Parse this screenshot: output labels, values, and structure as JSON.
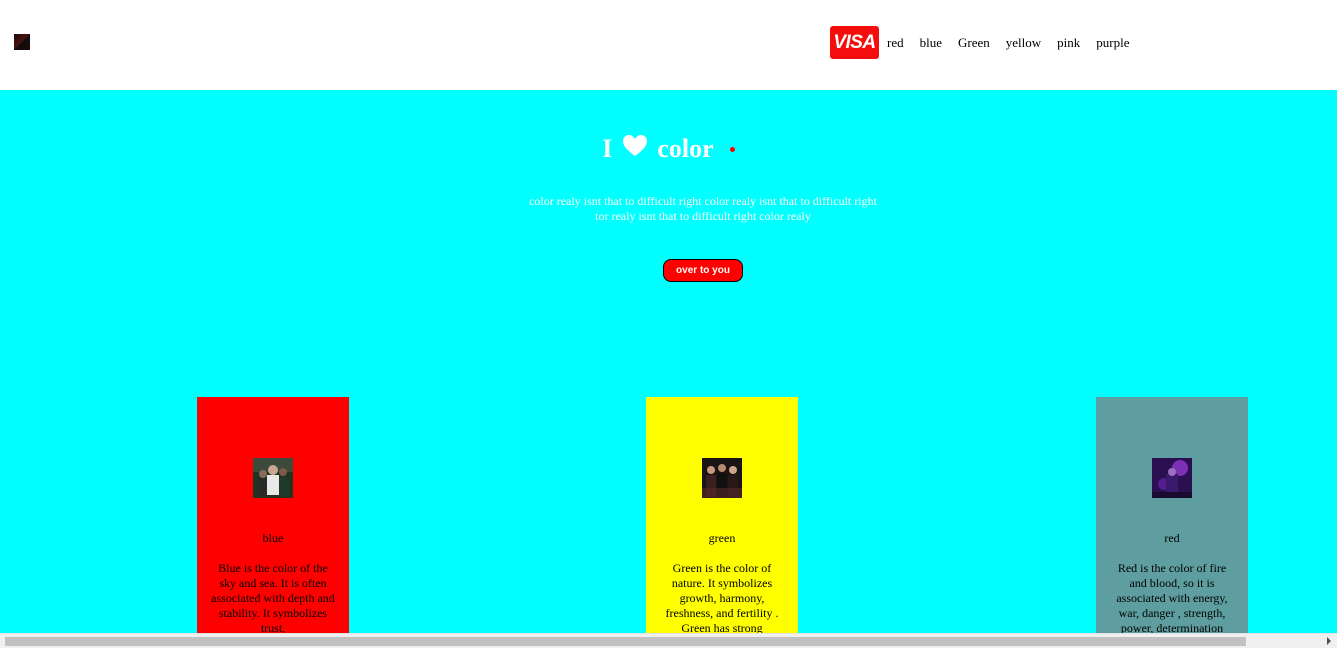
{
  "header": {
    "logo_icon": "dark-red-square-logo",
    "brand_badge": "VISA",
    "nav": [
      "red",
      "blue",
      "Green",
      "yellow",
      "pink",
      "purple"
    ]
  },
  "hero": {
    "title_prefix": "I",
    "title_icon": "heart-icon",
    "title_suffix": "color",
    "text": "color realy isnt that to difficult right color realy isnt that to difficult right tor realy isnt that to difficult right color realy",
    "cta_label": "over to you",
    "background": "#00ffff",
    "cta_color": "#ff0000"
  },
  "cards": [
    {
      "title": "blue",
      "text": "Blue is the color of the sky and sea. It is often associated with depth and stability. It symbolizes trust,",
      "background": "#ff0000",
      "thumb_icon": "photo-thumbnail"
    },
    {
      "title": "green",
      "text": "Green is the color of nature. It symbolizes growth, harmony, freshness, and fertility . Green has strong",
      "background": "#ffff00",
      "thumb_icon": "photo-thumbnail"
    },
    {
      "title": "red",
      "text": "Red is the color of fire and blood, so it is associated with energy, war, danger , strength, power, determination",
      "background": "#5f9ea0",
      "thumb_icon": "photo-thumbnail"
    }
  ]
}
